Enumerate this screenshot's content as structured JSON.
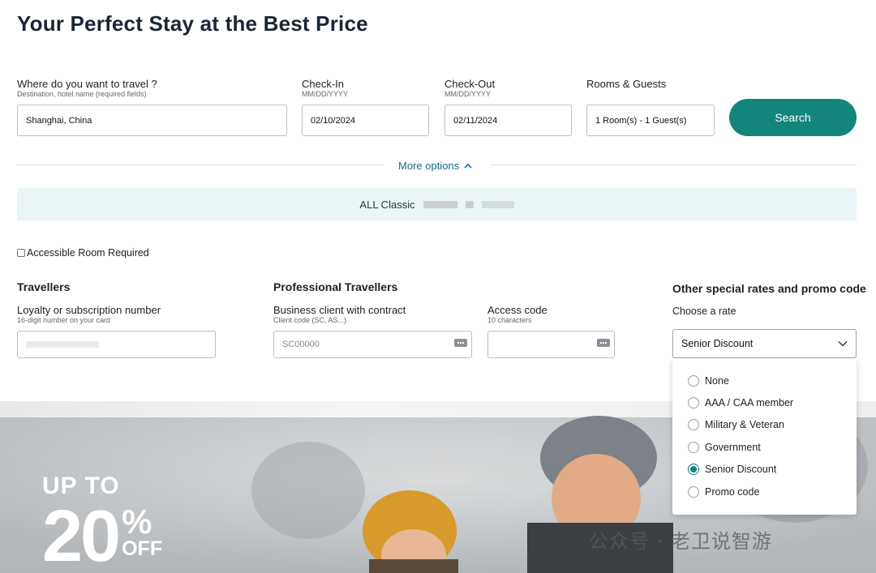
{
  "title": "Your Perfect Stay at the Best Price",
  "destination": {
    "label": "Where do you want to travel ?",
    "sublabel": "Destination, hotel name (required fields)",
    "value": "Shanghai, China"
  },
  "checkin": {
    "label": "Check-In",
    "sublabel": "MM/DD/YYYY",
    "value": "02/10/2024"
  },
  "checkout": {
    "label": "Check-Out",
    "sublabel": "MM/DD/YYYY",
    "value": "02/11/2024"
  },
  "rooms": {
    "label": "Rooms & Guests",
    "value": "1 Room(s) - 1 Guest(s)"
  },
  "search_label": "Search",
  "more_options_label": "More options",
  "classic_bar": {
    "label": "ALL Classic"
  },
  "accessible_label": "Accessible Room Required",
  "travellers": {
    "title": "Travellers",
    "loyalty_label": "Loyalty or subscription number",
    "loyalty_sublabel": "16-digit number on your card"
  },
  "professional": {
    "title": "Professional Travellers",
    "business_label": "Business client with contract",
    "business_sublabel": "Client code (SC, AS...)",
    "business_placeholder": "SC00000",
    "access_label": "Access code",
    "access_sublabel": "10 characters"
  },
  "special": {
    "title": "Other special rates and promo code",
    "choose_label": "Choose a rate",
    "selected": "Senior Discount",
    "options": [
      {
        "label": "None",
        "checked": false
      },
      {
        "label": "AAA / CAA member",
        "checked": false
      },
      {
        "label": "Military & Veteran",
        "checked": false
      },
      {
        "label": "Government",
        "checked": false
      },
      {
        "label": "Senior Discount",
        "checked": true
      },
      {
        "label": "Promo code",
        "checked": false
      }
    ]
  },
  "promo": {
    "line1": "UP TO",
    "percent": "20",
    "pct_sign": "%",
    "off": "OFF"
  },
  "watermark": "公众号 · 老卫说智游",
  "colors": {
    "accent": "#14857a",
    "link": "#1a6b8c",
    "bar_bg": "#e9f5f6"
  }
}
